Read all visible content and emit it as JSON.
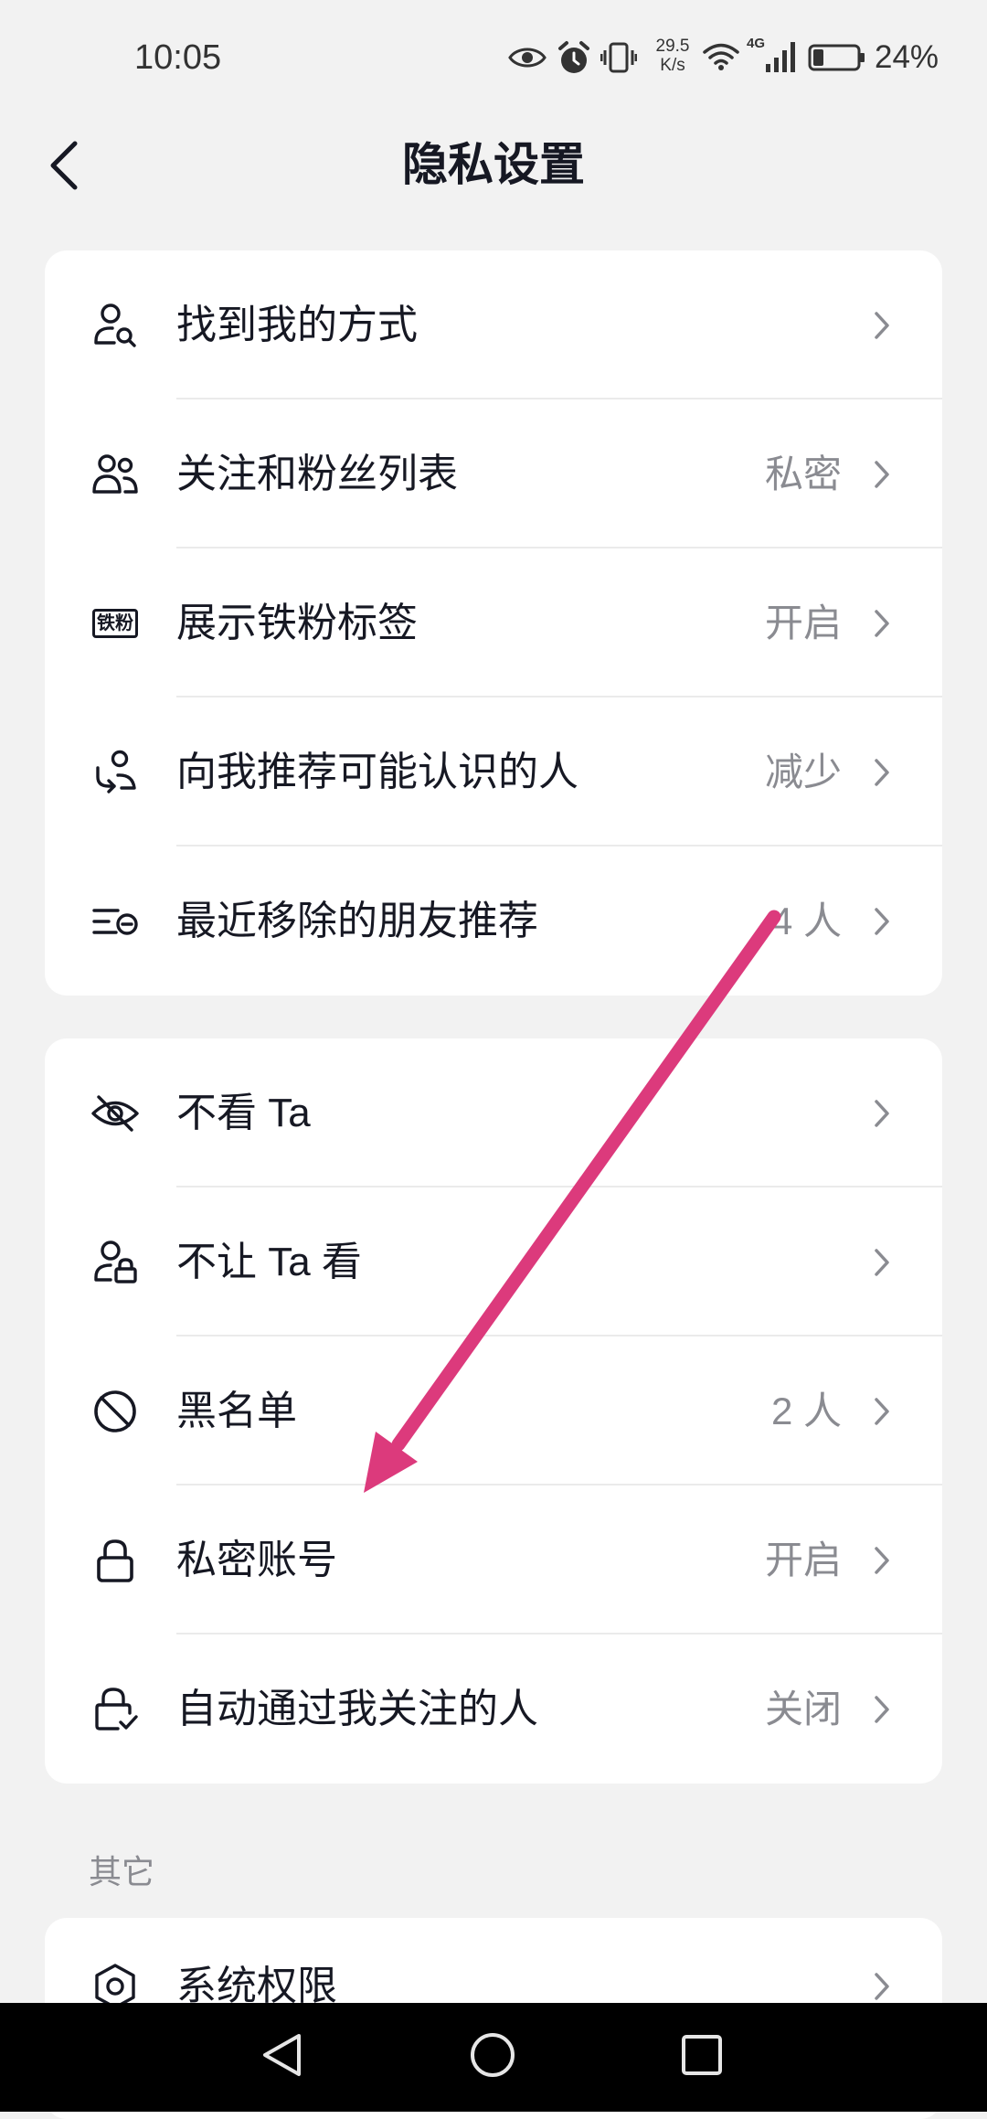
{
  "status_bar": {
    "time": "10:05",
    "net_speed_value": "29.5",
    "net_speed_unit": "K/s",
    "network_type": "4G",
    "battery_text": "24%",
    "battery_level": 0.24,
    "icons": [
      "eye-icon",
      "alarm-icon",
      "vibrate-icon",
      "wifi-icon",
      "signal-icon",
      "battery-icon"
    ]
  },
  "header": {
    "title": "隐私设置",
    "back_icon": "chevron-left-icon"
  },
  "groups": [
    {
      "rows": [
        {
          "label": "找到我的方式",
          "icon": "person-search-icon"
        },
        {
          "label": "关注和粉丝列表",
          "value": "私密",
          "icon": "people-icon"
        },
        {
          "label": "展示铁粉标签",
          "value": "开启",
          "icon": "fan-badge-icon",
          "badge_text": "铁粉"
        },
        {
          "label": "向我推荐可能认识的人",
          "value": "减少",
          "icon": "person-recommend-icon"
        },
        {
          "label": "最近移除的朋友推荐",
          "value": "4 人",
          "icon": "removed-list-icon"
        }
      ]
    },
    {
      "rows": [
        {
          "label": "不看 Ta",
          "icon": "eye-slash-icon"
        },
        {
          "label": "不让 Ta 看",
          "icon": "person-lock-icon"
        },
        {
          "label": "黑名单",
          "value": "2 人",
          "icon": "block-icon"
        },
        {
          "label": "私密账号",
          "value": "开启",
          "icon": "lock-icon"
        },
        {
          "label": "自动通过我关注的人",
          "value": "关闭",
          "icon": "lock-check-icon"
        }
      ]
    }
  ],
  "other_section": {
    "title": "其它",
    "rows": [
      {
        "label": "系统权限",
        "icon": "system-permission-icon"
      }
    ]
  },
  "nav_bar": {
    "icons": [
      "nav-back-icon",
      "nav-home-icon",
      "nav-recents-icon"
    ]
  },
  "colors": {
    "background": "#f2f2f2",
    "card": "#ffffff",
    "text_primary": "#161823",
    "text_secondary": "#8a8b91",
    "annotation_arrow": "#dc3a7c",
    "nav_bar": "#000000"
  }
}
